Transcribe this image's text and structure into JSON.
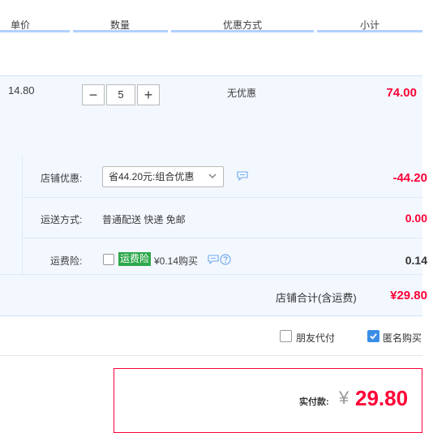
{
  "header": {
    "col_price": "单价",
    "col_qty": "数量",
    "col_discount": "优惠方式",
    "col_subtotal": "小计"
  },
  "item": {
    "unit_price": "14.80",
    "quantity": "5",
    "minus_symbol": "−",
    "plus_symbol": "+",
    "discount_method": "无优惠",
    "subtotal": "74.00"
  },
  "shop": {
    "discount_label": "店铺优惠:",
    "discount_select": "省44.20元:组合优惠",
    "discount_amount": "-44.20",
    "shipping_label": "运送方式:",
    "shipping_methods": "普通配送 快递 免邮",
    "shipping_fee": "0.00",
    "insurance_label": "运费险:",
    "insurance_badge": "运费险",
    "insurance_price": "¥0.14购买",
    "insurance_value": "0.14",
    "shop_total_label": "店铺合计(含运费)",
    "shop_total": "¥29.80"
  },
  "options": {
    "friend_pay_label": "朋友代付",
    "anonymous_label": "匿名购买",
    "friend_pay_checked": false,
    "anonymous_checked": true
  },
  "payment": {
    "label": "实付款:",
    "currency": "¥",
    "amount": "29.80"
  },
  "colors": {
    "accent_red": "#ff0036",
    "panel_blue": "#f3f8ff",
    "insurance_green": "#2ea84b",
    "checkbox_blue": "#3a8ee6"
  }
}
